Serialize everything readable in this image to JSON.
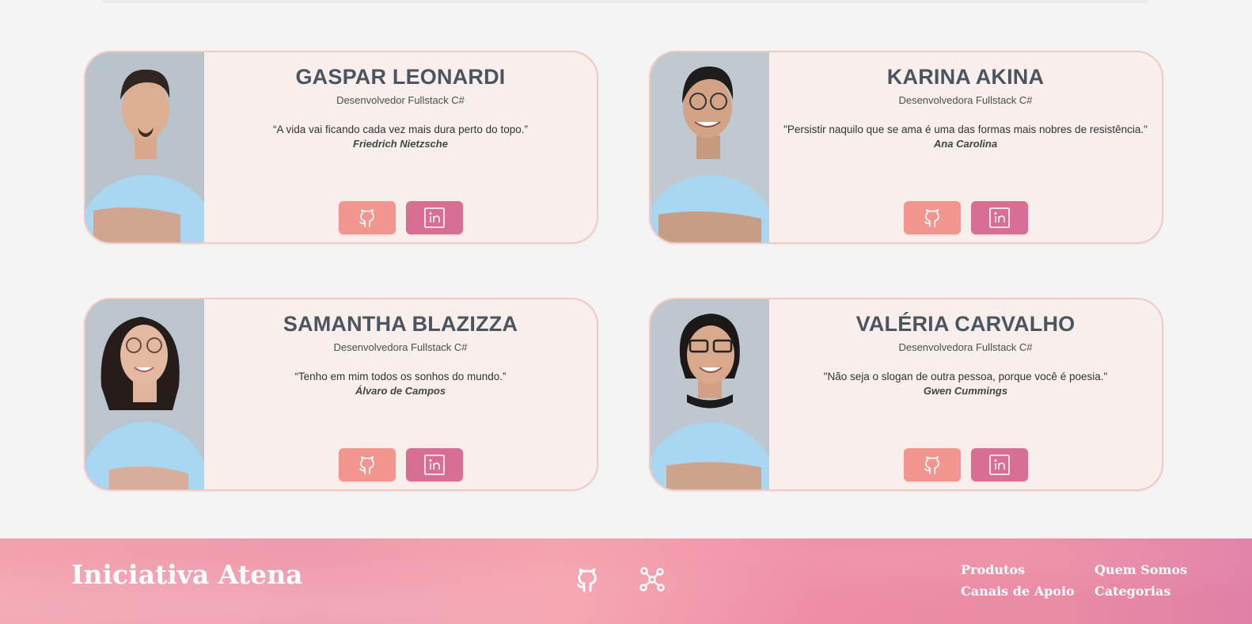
{
  "team": [
    {
      "name": "GASPAR LEONARDI",
      "role": "Desenvolvedor Fullstack C#",
      "quote": "“A vida vai ficando cada vez mais dura perto do topo.”",
      "author": "Friedrich Nietzsche"
    },
    {
      "name": "KARINA AKINA",
      "role": "Desenvolvedora Fullstack C#",
      "quote": "\"Persistir naquilo que se ama é uma das formas mais nobres de resistência.\"",
      "author": "Ana Carolina"
    },
    {
      "name": "SAMANTHA BLAZIZZA",
      "role": "Desenvolvedora Fullstack C#",
      "quote": "“Tenho em mim todos os sonhos do mundo.”",
      "author": "Álvaro de Campos"
    },
    {
      "name": "VALÉRIA CARVALHO",
      "role": "Desenvolvedora Fullstack C#",
      "quote": "\"Não seja o slogan de outra pessoa, porque você é poesia.\"",
      "author": "Gwen Cummings"
    }
  ],
  "icons": {
    "github": "github-icon",
    "linkedin": "linkedin-icon",
    "network": "network-icon"
  },
  "colors": {
    "card_bg": "#f8eeeb",
    "card_border": "#f1c9c2",
    "github_button": "#f2958f",
    "linkedin_button": "#d86e93"
  },
  "footer": {
    "brand": "Iniciativa Atena",
    "links": {
      "produtos": "Produtos",
      "canais": "Canais de Apoio",
      "quem_somos": "Quem Somos",
      "categorias": "Categorias"
    }
  }
}
